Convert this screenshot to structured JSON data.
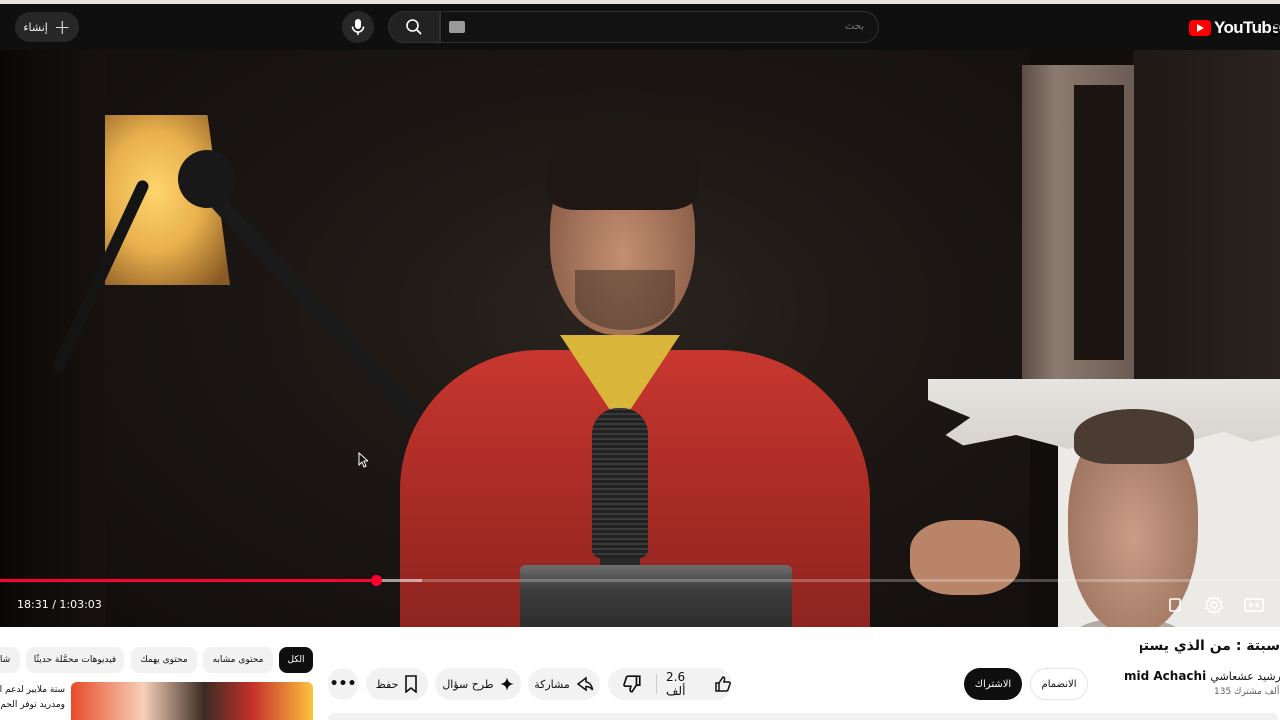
{
  "header": {
    "create_label": "إنشاء",
    "search_placeholder": "بحث",
    "logo_text": "YouTube",
    "country_code": "BR"
  },
  "player": {
    "current_time": "18:31",
    "duration": "1:03:03",
    "time_display": "18:31 / 1:03:03",
    "progress_fraction": 0.2937,
    "buffered_fraction": 0.294
  },
  "video": {
    "title": "سبتة : من الذي يستهدف",
    "channel_name": "Rachid Achachi - رشيد عشعاشي",
    "channel_name_latin": "mid Achachi",
    "channel_name_arabic": "رشيد عشعاشي -",
    "subscribers": "135 ألف مشترك",
    "subscribe_label": "الاشتراك",
    "join_label": "الانضمام",
    "likes": "2.6 ألف"
  },
  "actions": {
    "share_label": "مشاركة",
    "ask_label": "طرح سؤال",
    "save_label": "حفظ"
  },
  "chips": [
    {
      "label": "الكل",
      "active": true
    },
    {
      "label": "محتوى مشابه",
      "active": false
    },
    {
      "label": "محتوى يهمك",
      "active": false
    },
    {
      "label": "فيديوهات محمَّلة حديثًا",
      "active": false
    },
    {
      "label": "شا",
      "active": false
    }
  ],
  "recommendation": {
    "line1": "ستة ملايير لدعم الأ",
    "line2": "ومدريد توفر الحم"
  },
  "colors": {
    "accent": "#ff0033",
    "header_bg": "#0f0f0f",
    "brand_red": "#ff0000"
  }
}
